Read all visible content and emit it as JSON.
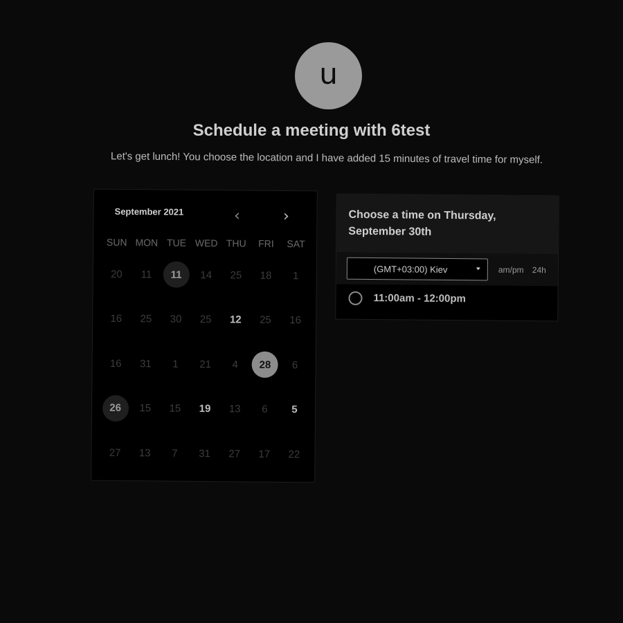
{
  "host": {
    "avatar_letter": "u",
    "title": "Schedule a meeting with 6test",
    "description": "Let's get lunch! You choose the location and I have added 15 minutes of travel time for myself."
  },
  "calendar": {
    "month_label": "September 2021",
    "prev_icon": "chevron-left-icon",
    "next_icon": "chevron-right-icon",
    "weekdays": [
      "SUN",
      "MON",
      "TUE",
      "WED",
      "THU",
      "FRI",
      "SAT"
    ],
    "days": [
      {
        "label": "20",
        "state": "disabled"
      },
      {
        "label": "11",
        "state": "disabled"
      },
      {
        "label": "11",
        "state": "highlight"
      },
      {
        "label": "14",
        "state": "disabled"
      },
      {
        "label": "25",
        "state": "disabled"
      },
      {
        "label": "18",
        "state": "disabled"
      },
      {
        "label": "1",
        "state": "disabled"
      },
      {
        "label": "16",
        "state": "disabled"
      },
      {
        "label": "25",
        "state": "disabled"
      },
      {
        "label": "30",
        "state": "disabled"
      },
      {
        "label": "25",
        "state": "disabled"
      },
      {
        "label": "12",
        "state": "available"
      },
      {
        "label": "25",
        "state": "disabled"
      },
      {
        "label": "16",
        "state": "disabled"
      },
      {
        "label": "16",
        "state": "disabled"
      },
      {
        "label": "31",
        "state": "disabled"
      },
      {
        "label": "1",
        "state": "disabled"
      },
      {
        "label": "21",
        "state": "disabled"
      },
      {
        "label": "4",
        "state": "disabled"
      },
      {
        "label": "28",
        "state": "selected"
      },
      {
        "label": "6",
        "state": "disabled"
      },
      {
        "label": "26",
        "state": "highlight"
      },
      {
        "label": "15",
        "state": "disabled"
      },
      {
        "label": "15",
        "state": "disabled"
      },
      {
        "label": "19",
        "state": "available"
      },
      {
        "label": "13",
        "state": "disabled"
      },
      {
        "label": "6",
        "state": "disabled"
      },
      {
        "label": "5",
        "state": "available"
      },
      {
        "label": "27",
        "state": "disabled"
      },
      {
        "label": "13",
        "state": "disabled"
      },
      {
        "label": "7",
        "state": "disabled"
      },
      {
        "label": "31",
        "state": "disabled"
      },
      {
        "label": "27",
        "state": "disabled"
      },
      {
        "label": "17",
        "state": "disabled"
      },
      {
        "label": "22",
        "state": "disabled"
      }
    ]
  },
  "times": {
    "heading": "Choose a time on Thursday, September 30th",
    "timezone": "(GMT+03:00) Kiev",
    "format_ampm": "am/pm",
    "format_24": "24h",
    "slots": [
      "11:00am - 12:00pm"
    ]
  },
  "colors": {
    "background": "#0a0a0a",
    "card": "#000000",
    "selected_day": "#8c8c8c",
    "highlight_day": "#1f1f1f"
  }
}
